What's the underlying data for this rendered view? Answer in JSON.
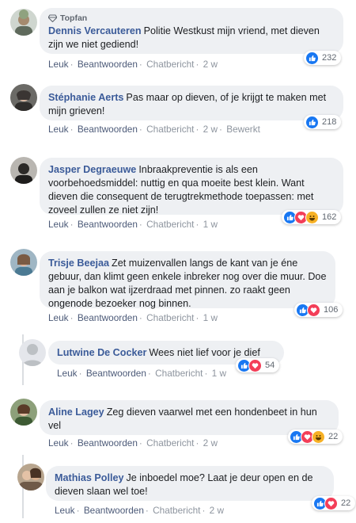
{
  "comments": [
    {
      "badge": "Topfan",
      "author": "Dennis Vercauteren",
      "text": "Politie Westkust mijn vriend, met dieven zijn we niet gediend!",
      "actions": {
        "like": "Leuk",
        "reply": "Beantwoorden",
        "chat": "Chatbericht",
        "time": "2 w"
      },
      "reaction_count": "232"
    },
    {
      "author": "Stéphanie Aerts",
      "text": "Pas maar op dieven, of je krijgt te maken met mijn grieven!",
      "actions": {
        "like": "Leuk",
        "reply": "Beantwoorden",
        "chat": "Chatbericht",
        "time": "2 w",
        "edited": "Bewerkt"
      },
      "reaction_count": "218"
    },
    {
      "author": "Jasper Degraeuwe",
      "text": "Inbraakpreventie is als een voorbehoedsmiddel: nuttig en qua moeite best klein. Want dieven die consequent de terugtrekmethode toepassen: met zoveel zullen ze niet zijn!",
      "actions": {
        "like": "Leuk",
        "reply": "Beantwoorden",
        "chat": "Chatbericht",
        "time": "1 w"
      },
      "reaction_count": "162"
    },
    {
      "author": "Trisje Beejaa",
      "text": "Zet muizenvallen langs de kant van je éne gebuur, dan klimt geen enkele inbreker nog over die muur. Doe aan je balkon wat ijzerdraad met pinnen. zo raakt geen ongenode bezoeker nog binnen.",
      "actions": {
        "like": "Leuk",
        "reply": "Beantwoorden",
        "chat": "Chatbericht",
        "time": "1 w"
      },
      "reaction_count": "106"
    },
    {
      "author": "Lutwine De Cocker",
      "text": "Wees niet lief voor je dief",
      "actions": {
        "like": "Leuk",
        "reply": "Beantwoorden",
        "chat": "Chatbericht",
        "time": "1 w"
      },
      "reaction_count": "54"
    },
    {
      "author": "Aline Lagey",
      "text": "Zeg dieven vaarwel met een hondenbeet in hun vel",
      "actions": {
        "like": "Leuk",
        "reply": "Beantwoorden",
        "chat": "Chatbericht",
        "time": "2 w"
      },
      "reaction_count": "22"
    },
    {
      "author": "Mathias Polley",
      "text": "Je inboedel moe? Laat je deur open en de dieven slaan wel toe!",
      "actions": {
        "like": "Leuk",
        "reply": "Beantwoorden",
        "chat": "Chatbericht",
        "time": "2 w"
      },
      "reaction_count": "22"
    }
  ],
  "colors": {
    "author": "#3b5b99",
    "like": "#1877f2",
    "love": "#f33e58",
    "haha": "#f7b125",
    "bubble": "#eef0f3"
  },
  "icons": {
    "badge": "diamond-icon",
    "reactions": [
      "like-icon",
      "love-icon",
      "haha-icon"
    ]
  }
}
